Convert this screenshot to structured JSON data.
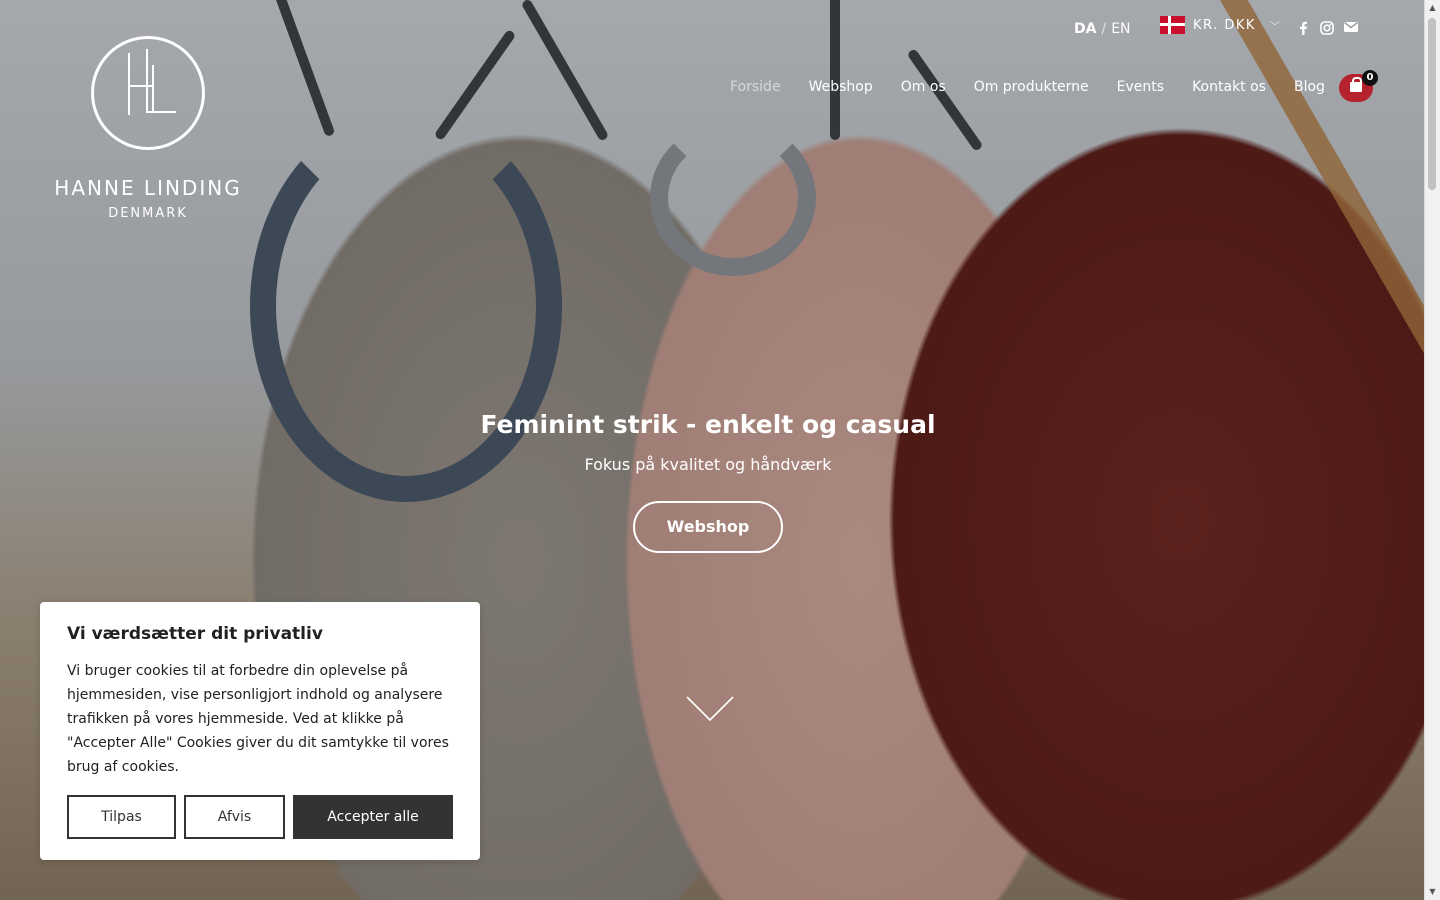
{
  "brand": {
    "name": "HANNE LINDING",
    "tagline": "DENMARK"
  },
  "topbar": {
    "languages": [
      "DA",
      "EN"
    ],
    "active_language": "DA",
    "language_separator": "/",
    "currency": "KR. DKK",
    "social_icons": [
      "facebook-icon",
      "instagram-icon",
      "email-icon"
    ]
  },
  "nav": {
    "items": [
      "Forside",
      "Webshop",
      "Om os",
      "Om produkterne",
      "Events",
      "Kontakt os",
      "Blog"
    ],
    "current": "Forside",
    "cart_count": "0"
  },
  "hero": {
    "title": "Feminint strik - enkelt og casual",
    "subtitle": "Fokus på kvalitet og håndværk",
    "button": "Webshop"
  },
  "cookie": {
    "title": "Vi værdsætter dit privatliv",
    "text": "Vi bruger cookies til at forbedre din oplevelse på hjemmesiden, vise personligjort indhold og analysere trafikken på vores hjemmeside. Ved at klikke på \"Accepter Alle\" Cookies giver du dit samtykke til vores brug af cookies.",
    "customize": "Tilpas",
    "reject": "Afvis",
    "accept": "Accepter alle"
  },
  "colors": {
    "cart_accent": "#b5212c",
    "flag_red": "#c8102e",
    "cookie_primary": "#333333"
  }
}
